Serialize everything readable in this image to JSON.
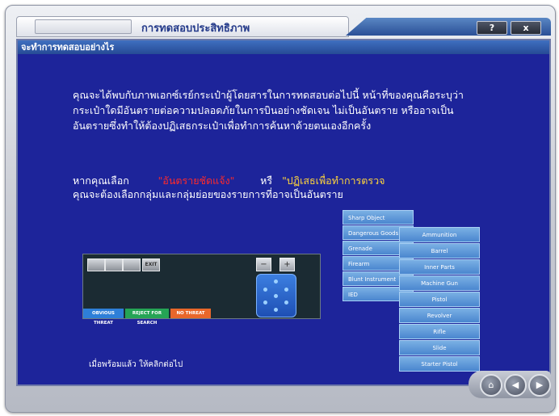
{
  "window": {
    "title": "การทดสอบประสิทธิภาพ",
    "help_label": "?",
    "close_label": "x"
  },
  "section": {
    "header": "จะทำการทดสอบอย่างไร"
  },
  "instructions": {
    "line1": "คุณจะได้พบกับภาพเอกซ์เรย์กระเป๋าผู้โดยสารในการทดสอบต่อไปนี้ หน้าที่ของคุณคือระบุว่า",
    "line2": "กระเป๋าใดมีอันตรายต่อความปลอดภัยในการบินอย่างชัดเจน ไม่เป็นอันตราย หรืออาจเป็น",
    "line3": "อันตรายซึ่งทำให้ต้องปฏิเสธกระเป๋าเพื่อทำการค้นหาด้วยตนเองอีกครั้ง"
  },
  "choice": {
    "prefix": "หากคุณเลือก",
    "option1": "\"อันตรายชัดแจ้ง\"",
    "or": "หรื",
    "option2": "\"ปฏิเสธเพื่อทำการตรวจ",
    "line2": "คุณจะต้องเลือกกลุ่มและกลุ่มย่อยของรายการที่อาจเป็นอันตราย"
  },
  "simulator": {
    "buttons": [
      "",
      "",
      "",
      "EXIT"
    ],
    "footer": [
      "OBVIOUS THREAT",
      "REJECT FOR SEARCH",
      "NO THREAT"
    ],
    "footer_colors": [
      "#2e7fd8",
      "#25a455",
      "#e8672a"
    ]
  },
  "categories": [
    "Sharp Object",
    "Dangerous Goods",
    "Grenade",
    "Firearm",
    "Blunt Instrument",
    "IED"
  ],
  "subcategories": [
    "Ammunition",
    "Barrel",
    "Inner Parts",
    "Machine Gun",
    "Pistol",
    "Revolver",
    "Rifle",
    "Slide",
    "Starter Pistol"
  ],
  "footer": {
    "ready_text": "เมื่อพร้อมแล้ว ให้คลิกต่อไป"
  }
}
